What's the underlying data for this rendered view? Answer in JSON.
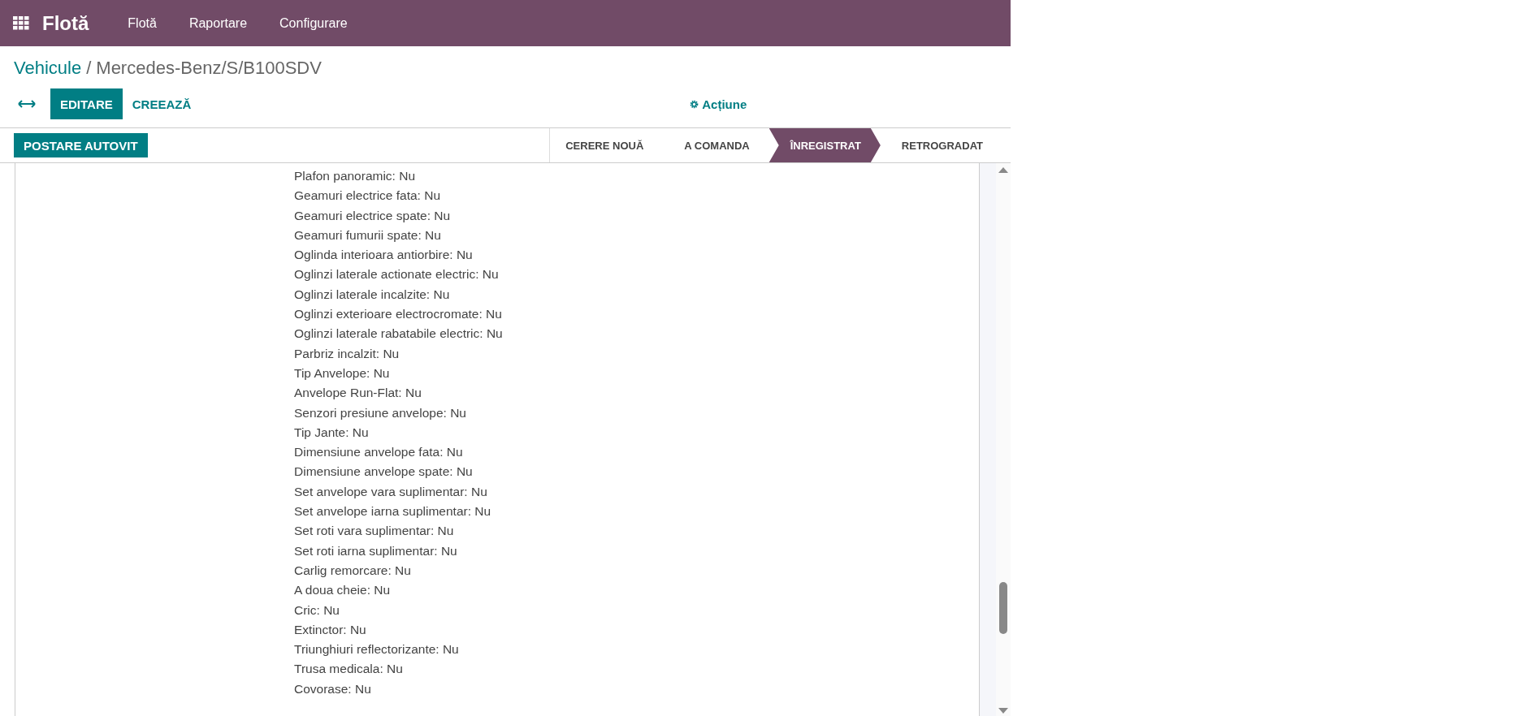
{
  "navbar": {
    "app_title": "Flotă",
    "menu": [
      "Flotă",
      "Raportare",
      "Configurare"
    ]
  },
  "breadcrumb": {
    "parent": "Vehicule",
    "separator": "/",
    "current": "Mercedes-Benz/S/B100SDV"
  },
  "control_panel": {
    "edit_button": "EDITARE",
    "create_button": "CREEAZĂ",
    "action_menu": "Acțiune"
  },
  "header": {
    "button": "POSTARE AUTOVIT",
    "stages": [
      {
        "label": "CERERE NOUĂ",
        "selected": false
      },
      {
        "label": "A COMANDA",
        "selected": false
      },
      {
        "label": "ÎNREGISTRAT",
        "selected": true
      },
      {
        "label": "RETROGRADAT",
        "selected": false
      }
    ]
  },
  "fields": [
    "Plafon panoramic: Nu",
    "Geamuri electrice fata: Nu",
    "Geamuri electrice spate: Nu",
    "Geamuri fumurii spate: Nu",
    "Oglinda interioara antiorbire: Nu",
    "Oglinzi laterale actionate electric: Nu",
    "Oglinzi laterale incalzite: Nu",
    "Oglinzi exterioare electrocromate: Nu",
    "Oglinzi laterale rabatabile electric: Nu",
    "Parbriz incalzit: Nu",
    "Tip Anvelope: Nu",
    "Anvelope Run-Flat: Nu",
    "Senzori presiune anvelope: Nu",
    "Tip Jante: Nu",
    "Dimensiune anvelope fata: Nu",
    "Dimensiune anvelope spate: Nu",
    "Set anvelope vara suplimentar: Nu",
    "Set anvelope iarna suplimentar: Nu",
    "Set roti vara suplimentar: Nu",
    "Set roti iarna suplimentar: Nu",
    "Carlig remorcare: Nu",
    "A doua cheie: Nu",
    "Cric: Nu",
    "Extinctor: Nu",
    "Triunghiuri reflectorizante: Nu",
    "Trusa medicala: Nu",
    "Covorase: Nu"
  ]
}
